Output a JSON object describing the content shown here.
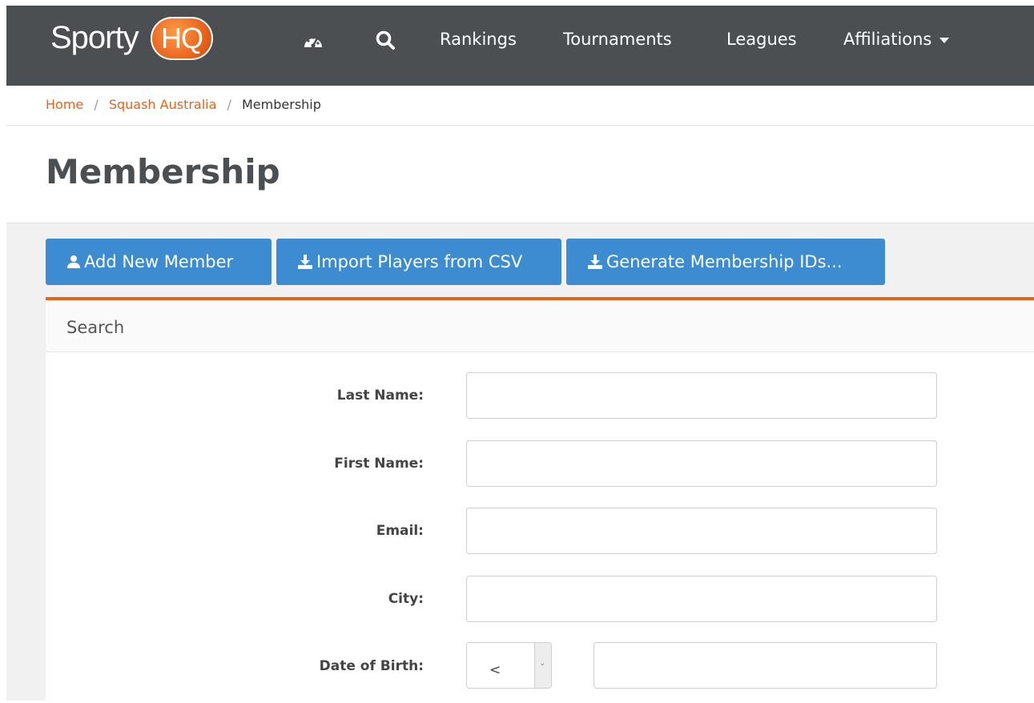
{
  "nav": {
    "logo_left": "Sporty",
    "logo_right": "HQ",
    "links": [
      "Rankings",
      "Tournaments",
      "Leagues",
      "Affiliations"
    ],
    "icons": [
      "dashboard-icon",
      "search-icon",
      "caret-down-icon"
    ]
  },
  "breadcrumb": {
    "home": "Home",
    "org": "Squash Australia",
    "current": "Membership",
    "sep": "/"
  },
  "page": {
    "title": "Membership"
  },
  "actions": {
    "add_member": "Add New Member",
    "import_csv": "Import Players from CSV",
    "generate_ids": "Generate Membership IDs..."
  },
  "search": {
    "title": "Search",
    "last_name_label": "Last Name:",
    "first_name_label": "First Name:",
    "email_label": "Email:",
    "city_label": "City:",
    "dob_label": "Date of Birth:",
    "dob_operator": "<",
    "last_name_value": "",
    "first_name_value": "",
    "email_value": "",
    "city_value": "",
    "dob_value": ""
  },
  "colors": {
    "nav_bg": "#4b4f52",
    "accent": "#e8621a",
    "button": "#3d8bd1"
  }
}
